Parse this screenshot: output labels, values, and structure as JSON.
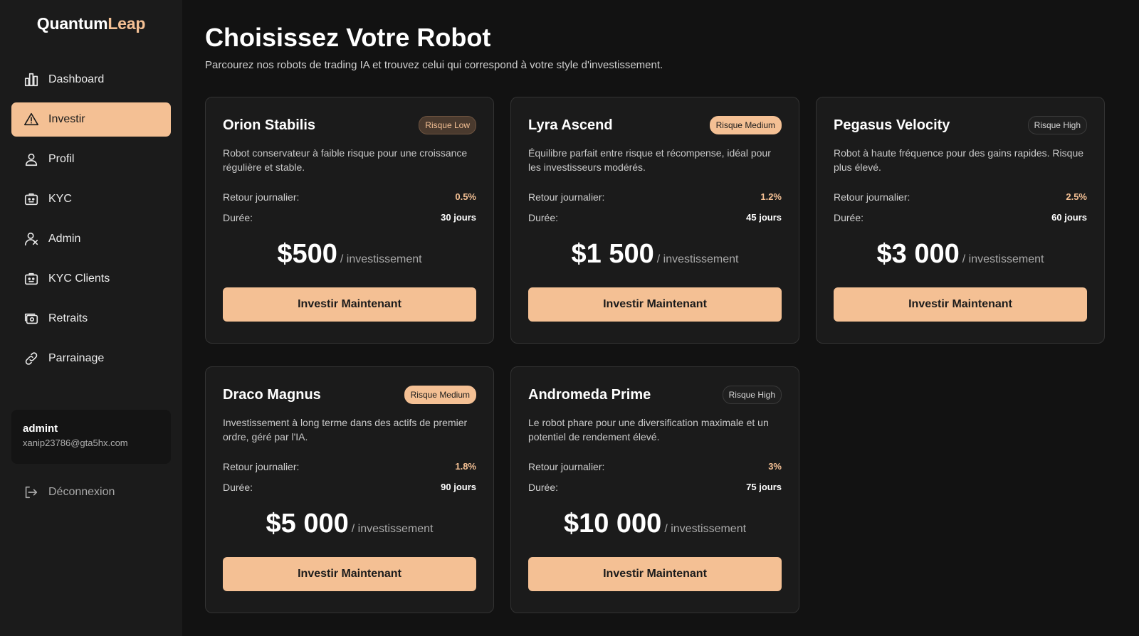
{
  "app": {
    "logo_part1": "Quantum",
    "logo_part2": "Leap"
  },
  "colors": {
    "accent": "#f4c094",
    "background": "#121212",
    "sidebar": "#1b1b1b",
    "card": "#1b1b1b"
  },
  "sidebar": {
    "items": [
      {
        "label": "Dashboard",
        "icon": "bar-chart-icon",
        "active": false
      },
      {
        "label": "Investir",
        "icon": "warning-triangle-icon",
        "active": true
      },
      {
        "label": "Profil",
        "icon": "user-icon",
        "active": false
      },
      {
        "label": "KYC",
        "icon": "id-card-icon",
        "active": false
      },
      {
        "label": "Admin",
        "icon": "user-shield-icon",
        "active": false
      },
      {
        "label": "KYC Clients",
        "icon": "id-card-icon",
        "active": false
      },
      {
        "label": "Retraits",
        "icon": "cash-icon",
        "active": false
      },
      {
        "label": "Parrainage",
        "icon": "link-icon",
        "active": false
      }
    ],
    "user": {
      "name": "admint",
      "email": "xanip23786@gta5hx.com"
    },
    "logout_label": "Déconnexion"
  },
  "main": {
    "title": "Choisissez Votre Robot",
    "subtitle": "Parcourez nos robots de trading IA et trouvez celui qui correspond à votre style d'investissement.",
    "labels": {
      "daily_return": "Retour journalier:",
      "duration": "Durée:",
      "per_investment": "/ investissement",
      "invest_button": "Investir Maintenant"
    },
    "robots": [
      {
        "name": "Orion Stabilis",
        "risk": "Risque Low",
        "risk_level": "low",
        "description": "Robot conservateur à faible risque pour une croissance régulière et stable.",
        "daily_return": "0.5%",
        "duration": "30 jours",
        "price": "$500"
      },
      {
        "name": "Lyra Ascend",
        "risk": "Risque Medium",
        "risk_level": "medium",
        "description": "Équilibre parfait entre risque et récompense, idéal pour les investisseurs modérés.",
        "daily_return": "1.2%",
        "duration": "45 jours",
        "price": "$1 500"
      },
      {
        "name": "Pegasus Velocity",
        "risk": "Risque High",
        "risk_level": "high",
        "description": "Robot à haute fréquence pour des gains rapides. Risque plus élevé.",
        "daily_return": "2.5%",
        "duration": "60 jours",
        "price": "$3 000"
      },
      {
        "name": "Draco Magnus",
        "risk": "Risque Medium",
        "risk_level": "medium",
        "description": "Investissement à long terme dans des actifs de premier ordre, géré par l'IA.",
        "daily_return": "1.8%",
        "duration": "90 jours",
        "price": "$5 000"
      },
      {
        "name": "Andromeda Prime",
        "risk": "Risque High",
        "risk_level": "high",
        "description": "Le robot phare pour une diversification maximale et un potentiel de rendement élevé.",
        "daily_return": "3%",
        "duration": "75 jours",
        "price": "$10 000"
      }
    ]
  }
}
